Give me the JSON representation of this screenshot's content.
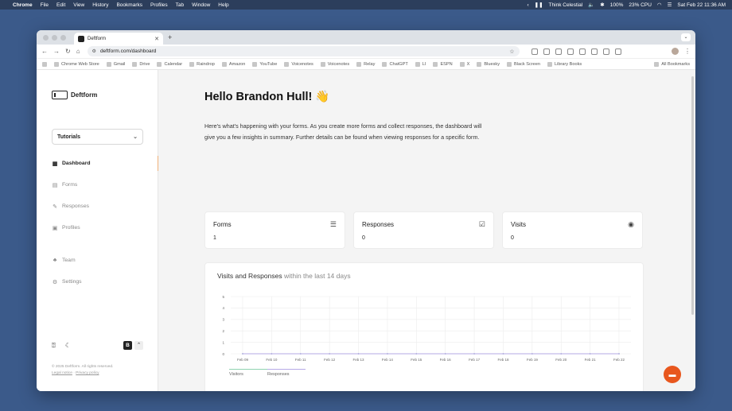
{
  "menubar": {
    "app_name": "Chrome",
    "items": [
      "File",
      "Edit",
      "View",
      "History",
      "Bookmarks",
      "Profiles",
      "Tab",
      "Window",
      "Help"
    ],
    "now_playing": "Think Celestial",
    "battery": "100%",
    "cpu": "23% CPU",
    "datetime": "Sat Feb 22  11:36 AM"
  },
  "browser": {
    "tab_title": "Deftform",
    "url_host": "deftform.com",
    "url_path": "/dashboard",
    "bookmarks": [
      "Chrome Web Store",
      "Gmail",
      "Drive",
      "Calendar",
      "Raindrop",
      "Amazon",
      "YouTube",
      "Voicenotes",
      "Voicenotes",
      "Relay",
      "ChatGPT",
      "LI",
      "ESPN",
      "X",
      "Bluesky",
      "Black Screen",
      "Library Books"
    ],
    "all_bookmarks": "All Bookmarks"
  },
  "sidebar": {
    "logo_text": "Deftform",
    "workspace": "Tutorials",
    "nav": [
      {
        "label": "Dashboard",
        "icon": "grid-icon"
      },
      {
        "label": "Forms",
        "icon": "forms-icon"
      },
      {
        "label": "Responses",
        "icon": "pen-icon"
      },
      {
        "label": "Profiles",
        "icon": "profile-icon"
      },
      {
        "label": "Team",
        "icon": "team-icon"
      },
      {
        "label": "Settings",
        "icon": "gear-icon"
      }
    ],
    "kbd_letter": "B",
    "footer_copyright": "© 2025 Deftform. All rights reserved.",
    "footer_legal": "Legal notice",
    "footer_separator": "·",
    "footer_privacy": "Privacy policy"
  },
  "main": {
    "greeting": "Hello Brandon Hull! 👋",
    "intro": "Here's what's happening with your forms. As you create more forms and collect responses, the dashboard will give you a few insights in summary. Further details can be found when viewing responses for a specific form.",
    "stats": [
      {
        "label": "Forms",
        "value": "1",
        "icon": "inbox-stack-icon"
      },
      {
        "label": "Responses",
        "value": "0",
        "icon": "checklist-icon"
      },
      {
        "label": "Visits",
        "value": "0",
        "icon": "eye-icon"
      }
    ],
    "chart_title": "Visits and Responses",
    "chart_subtitle": "within the last 14 days"
  },
  "chart_data": {
    "type": "line",
    "title": "Visits and Responses within the last 14 days",
    "categories": [
      "Feb 09",
      "Feb 10",
      "Feb 11",
      "Feb 12",
      "Feb 13",
      "Feb 14",
      "Feb 15",
      "Feb 16",
      "Feb 17",
      "Feb 18",
      "Feb 19",
      "Feb 20",
      "Feb 21",
      "Feb 22"
    ],
    "series": [
      {
        "name": "Visitors",
        "values": [
          0,
          0,
          0,
          0,
          0,
          0,
          0,
          0,
          0,
          0,
          0,
          0,
          0,
          0
        ],
        "color": "#8fd3b0"
      },
      {
        "name": "Responses",
        "values": [
          0,
          0,
          0,
          0,
          0,
          0,
          0,
          0,
          0,
          0,
          0,
          0,
          0,
          0
        ],
        "color": "#b6a9e6"
      }
    ],
    "ylim": [
      0,
      5
    ],
    "yticks": [
      "0",
      "1",
      "2",
      "3",
      "4",
      "5"
    ],
    "grid": true,
    "legend": "bottom-left"
  },
  "colors": {
    "accent": "#e8571e",
    "active_indicator": "#f0b27a"
  }
}
